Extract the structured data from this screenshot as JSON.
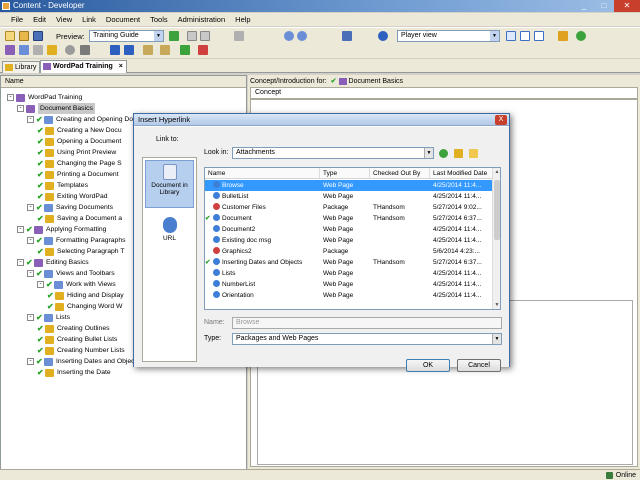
{
  "window": {
    "title": "Content - Developer"
  },
  "menu": [
    "File",
    "Edit",
    "View",
    "Link",
    "Document",
    "Tools",
    "Administration",
    "Help"
  ],
  "toolbar": {
    "preview_label": "Preview:",
    "preview_value": "Training Guide",
    "view_value": "Player view"
  },
  "doc_tabs": [
    {
      "label": "Library"
    },
    {
      "label": "WordPad Training",
      "close": "×"
    }
  ],
  "tree": {
    "column_header": "Name",
    "rows": [
      {
        "label": "WordPad Training",
        "depth": 0,
        "check": false,
        "exp": "-",
        "color": "#8a5fb8"
      },
      {
        "label": "Document Basics",
        "depth": 1,
        "check": false,
        "exp": "-",
        "color": "#8a5fb8",
        "selected": true
      },
      {
        "label": "Creating and Opening Do",
        "depth": 2,
        "check": true,
        "exp": "-",
        "color": "#6a8fd6"
      },
      {
        "label": "Creating a New Docu",
        "depth": 3,
        "check": true,
        "color": "#e0b020"
      },
      {
        "label": "Opening a Document",
        "depth": 3,
        "check": true,
        "color": "#e0b020"
      },
      {
        "label": "Using Print Preview",
        "depth": 3,
        "check": true,
        "color": "#e0b020"
      },
      {
        "label": "Changing the Page S",
        "depth": 3,
        "check": true,
        "color": "#e0b020"
      },
      {
        "label": "Printing a Document",
        "depth": 3,
        "check": true,
        "color": "#e0b020"
      },
      {
        "label": "Templates",
        "depth": 3,
        "check": true,
        "color": "#e0b020"
      },
      {
        "label": "Exiting WordPad",
        "depth": 3,
        "check": true,
        "color": "#e0b020"
      },
      {
        "label": "Saving Documents",
        "depth": 2,
        "check": true,
        "exp": "-",
        "color": "#6a8fd6"
      },
      {
        "label": "Saving a Document a",
        "depth": 3,
        "check": true,
        "color": "#e0b020"
      },
      {
        "label": "Applying Formatting",
        "depth": 1,
        "check": true,
        "exp": "-",
        "color": "#8a5fb8"
      },
      {
        "label": "Formatting Paragraphs",
        "depth": 2,
        "check": true,
        "exp": "-",
        "color": "#6a8fd6"
      },
      {
        "label": "Selecting Paragraph T",
        "depth": 3,
        "check": true,
        "color": "#e0b020"
      },
      {
        "label": "Editing Basics",
        "depth": 1,
        "check": true,
        "exp": "-",
        "color": "#8a5fb8"
      },
      {
        "label": "Views and Toolbars",
        "depth": 2,
        "check": true,
        "exp": "-",
        "color": "#6a8fd6"
      },
      {
        "label": "Work with Views",
        "depth": 3,
        "check": true,
        "exp": "-",
        "color": "#6a8fd6"
      },
      {
        "label": "Hiding and Display",
        "depth": 4,
        "check": true,
        "color": "#e0b020"
      },
      {
        "label": "Changing Word W",
        "depth": 4,
        "check": true,
        "color": "#e0b020"
      },
      {
        "label": "Lists",
        "depth": 2,
        "check": true,
        "exp": "-",
        "color": "#6a8fd6"
      },
      {
        "label": "Creating Outlines",
        "depth": 3,
        "check": true,
        "color": "#e0b020"
      },
      {
        "label": "Creating Bullet Lists",
        "depth": 3,
        "check": true,
        "color": "#e0b020"
      },
      {
        "label": "Creating Number Lists",
        "depth": 3,
        "check": true,
        "color": "#e0b020"
      },
      {
        "label": "Inserting Dates and Objec",
        "depth": 2,
        "check": true,
        "exp": "-",
        "color": "#6a8fd6"
      },
      {
        "label": "Inserting the Date",
        "depth": 3,
        "check": true,
        "color": "#e0b020"
      }
    ]
  },
  "right_pane": {
    "header_prefix": "Concept/Introduction for:",
    "header_doc": "Document Basics",
    "tab": "Concept"
  },
  "status": {
    "online": "Online"
  },
  "dialog": {
    "title": "Insert Hyperlink",
    "close": "X",
    "link_to_label": "Link to:",
    "link_to_items": [
      "Document in Library",
      "URL"
    ],
    "look_in_label": "Look in:",
    "look_in_value": "Attachments",
    "columns": [
      "Name",
      "Type",
      "Checked Out By",
      "Last Modified Date"
    ],
    "files": [
      {
        "check": false,
        "name": "Browse",
        "type": "Web Page",
        "by": "",
        "date": "4/25/2014 11:4...",
        "color": "#3d7fd8",
        "selected": true
      },
      {
        "check": false,
        "name": "BulletList",
        "type": "Web Page",
        "by": "",
        "date": "4/25/2014 11:4...",
        "color": "#3d7fd8"
      },
      {
        "check": false,
        "name": "Customer Files",
        "type": "Package",
        "by": "THandsom",
        "date": "5/27/2014 9:02...",
        "color": "#d04040"
      },
      {
        "check": true,
        "name": "Document",
        "type": "Web Page",
        "by": "THandsom",
        "date": "5/27/2014 6:37...",
        "color": "#3d7fd8"
      },
      {
        "check": false,
        "name": "Document2",
        "type": "Web Page",
        "by": "",
        "date": "4/25/2014 11:4...",
        "color": "#3d7fd8"
      },
      {
        "check": false,
        "name": "Existing doc msg",
        "type": "Web Page",
        "by": "",
        "date": "4/25/2014 11:4...",
        "color": "#3d7fd8"
      },
      {
        "check": false,
        "name": "Graphics2",
        "type": "Package",
        "by": "",
        "date": "5/6/2014 4:23:...",
        "color": "#d04040"
      },
      {
        "check": true,
        "name": "Inserting Dates and Objects",
        "type": "Web Page",
        "by": "THandsom",
        "date": "5/27/2014 6:37...",
        "color": "#3d7fd8"
      },
      {
        "check": false,
        "name": "Lists",
        "type": "Web Page",
        "by": "",
        "date": "4/25/2014 11:4...",
        "color": "#3d7fd8"
      },
      {
        "check": false,
        "name": "NumberList",
        "type": "Web Page",
        "by": "",
        "date": "4/25/2014 11:4...",
        "color": "#3d7fd8"
      },
      {
        "check": false,
        "name": "Orientation",
        "type": "Web Page",
        "by": "",
        "date": "4/25/2014 11:4...",
        "color": "#3d7fd8"
      }
    ],
    "name_label": "Name:",
    "name_value": "Browse",
    "type_label": "Type:",
    "type_value": "Packages and Web Pages",
    "ok": "OK",
    "cancel": "Cancel"
  }
}
